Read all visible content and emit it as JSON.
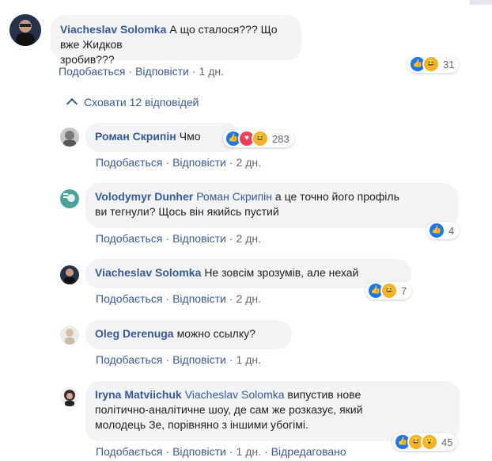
{
  "comments": [
    {
      "name": "Viacheslav Solomka",
      "text_line1": "А що сталося??? Що вже Жидков",
      "text_line2": "зробив???",
      "reactions_count": "31",
      "like_label": "Подобається",
      "reply_label": "Відповісти",
      "time": "1 дн."
    }
  ],
  "hide_replies": "Сховати 12 відповідей",
  "replies": [
    {
      "name": "Роман Скрипін",
      "text": "Чмо",
      "reactions_count": "283",
      "like_label": "Подобається",
      "reply_label": "Відповісти",
      "time": "2 дн."
    },
    {
      "name": "Volodymyr Dunher",
      "mention": "Роман Скрипін",
      "text_line1": " а це точно його профіль",
      "text_line2": "ви тегнули? Щось він якийсь пустий",
      "reactions_count": "4",
      "like_label": "Подобається",
      "reply_label": "Відповісти",
      "time": "2 дн."
    },
    {
      "name": "Viacheslav Solomka",
      "text": "Не зовсім зрозумів, але нехай",
      "reactions_count": "7",
      "like_label": "Подобається",
      "reply_label": "Відповісти",
      "time": "2 дн."
    },
    {
      "name": "Oleg Derenuga",
      "text": "можно ссылку?",
      "like_label": "Подобається",
      "reply_label": "Відповісти",
      "time": "1 дн."
    },
    {
      "name": "Iryna Matviichuk",
      "mention": "Viacheslav Solomka",
      "text_line1": " випустив нове",
      "text_line2": "політично-аналітичне шоу, де сам же розказує, який",
      "text_line3": "молодець Зе, порівняно з іншими убогімі.",
      "reactions_count": "45",
      "like_label": "Подобається",
      "reply_label": "Відповісти",
      "time": "1 дн.",
      "edited": "Відредаговано"
    }
  ],
  "colors": {
    "link": "#385898",
    "bubble": "#f2f3f5",
    "like": "#1877f2",
    "love": "#f33e58",
    "haha": "#f7b125"
  }
}
